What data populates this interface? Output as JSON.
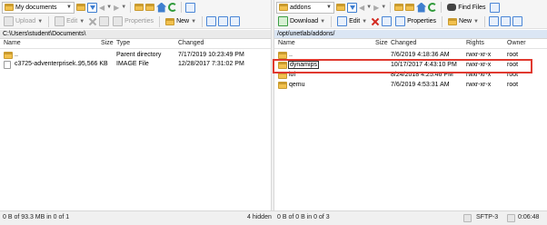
{
  "left": {
    "location": "My documents",
    "toolbar": {
      "upload": "Upload",
      "edit": "Edit",
      "properties": "Properties",
      "new": "New"
    },
    "path": "C:\\Users\\student\\Documents\\",
    "columns": {
      "name": "Name",
      "size": "Size",
      "type": "Type",
      "changed": "Changed"
    },
    "rows": [
      {
        "name": "..",
        "size": "",
        "type": "Parent directory",
        "changed": "7/17/2019  10:23:49 PM",
        "icon": "parent-folder-icon"
      },
      {
        "name": "c3725-adventerprisek...",
        "size": "95,566 KB",
        "type": "IMAGE File",
        "changed": "12/28/2017  7:31:02 PM",
        "icon": "file-icon"
      }
    ],
    "status": "0 B of 93.3 MB in 0 of 1",
    "hidden": "4 hidden"
  },
  "right": {
    "location": "addons",
    "toolbar": {
      "download": "Download",
      "edit": "Edit",
      "properties": "Properties",
      "new": "New",
      "find": "Find Files"
    },
    "path": "/opt/unetlab/addons/",
    "columns": {
      "name": "Name",
      "size": "Size",
      "changed": "Changed",
      "rights": "Rights",
      "owner": "Owner"
    },
    "rows": [
      {
        "name": "..",
        "changed": "7/6/2019  4:18:36 AM",
        "rights": "rwxr-xr-x",
        "owner": "root"
      },
      {
        "name": "dynamips",
        "changed": "10/17/2017  4:43:10 PM",
        "rights": "rwxr-xr-x",
        "owner": "root"
      },
      {
        "name": "iol",
        "changed": "8/24/2018  4:25:46 PM",
        "rights": "rwxr-xr-x",
        "owner": "root"
      },
      {
        "name": "qemu",
        "changed": "7/6/2019  4:53:31 AM",
        "rights": "rwxr-xr-x",
        "owner": "root"
      }
    ],
    "status": "0 B of 0 B in 0 of 3",
    "protocol": "SFTP-3",
    "time": "0:06:48"
  },
  "colors": {
    "highlight": "#e0392f",
    "folder": "#f2c14e",
    "accent": "#3f7fcf"
  }
}
